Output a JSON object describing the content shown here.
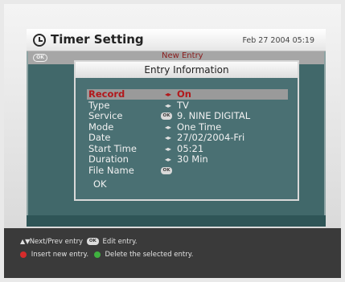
{
  "window": {
    "title": "Timer Setting",
    "datetime": "Feb 27 2004 05:19",
    "ok_key_label": "OK",
    "background_title": "New Entry"
  },
  "dialog": {
    "title": "Entry Information",
    "rows": [
      {
        "label": "Record",
        "control": "lr",
        "value": "On",
        "selected": true
      },
      {
        "label": "Type",
        "control": "lr",
        "value": "TV"
      },
      {
        "label": "Service",
        "control": "ok",
        "value": "9. NINE DIGITAL"
      },
      {
        "label": "Mode",
        "control": "lr",
        "value": "One Time"
      },
      {
        "label": "Date",
        "control": "lr",
        "value": "27/02/2004-Fri"
      },
      {
        "label": "Start Time",
        "control": "lr",
        "value": "05:21"
      },
      {
        "label": "Duration",
        "control": "lr",
        "value": "30 Min"
      },
      {
        "label": "File Name",
        "control": "ok",
        "value": ""
      }
    ],
    "ok_label": "OK",
    "ok_icon_text": "OK"
  },
  "footer": {
    "line1_nav": "Next/Prev entry",
    "line1_ok": "OK",
    "line1_edit": "Edit entry.",
    "line2_insert": "Insert new entry.",
    "line2_delete": "Delete the selected entry."
  },
  "colors": {
    "panel_bg": "#41686a",
    "selected_text": "#b2181b",
    "red_button": "#d62b2b",
    "green_button": "#3fb13f"
  }
}
